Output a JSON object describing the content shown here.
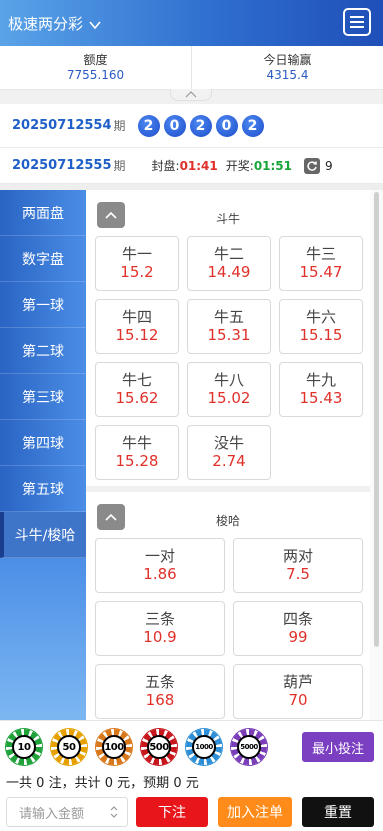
{
  "header": {
    "title": "极速两分彩",
    "title_icon": "chevron-down-icon",
    "menu_icon": "hamburger-menu-icon"
  },
  "balance": {
    "credit_label": "额度",
    "credit_value": "7755.160",
    "today_label": "今日输赢",
    "today_value": "4315.4"
  },
  "last_draw": {
    "issue": "20250712554",
    "unit": "期",
    "balls": [
      "2",
      "0",
      "2",
      "0",
      "2"
    ]
  },
  "next_draw": {
    "issue": "20250712555",
    "unit": "期",
    "close_label": "封盘:",
    "close_time": "01:41",
    "open_label": "开奖:",
    "open_time": "01:51",
    "refresh_icon": "refresh-icon",
    "refresh_count": "9"
  },
  "sidebar": {
    "items": [
      {
        "label": "两面盘",
        "active": false
      },
      {
        "label": "数字盘",
        "active": false
      },
      {
        "label": "第一球",
        "active": false
      },
      {
        "label": "第二球",
        "active": false
      },
      {
        "label": "第三球",
        "active": false
      },
      {
        "label": "第四球",
        "active": false
      },
      {
        "label": "第五球",
        "active": false
      },
      {
        "label": "斗牛/梭哈",
        "active": true
      }
    ]
  },
  "sections": [
    {
      "title": "斗牛",
      "options": [
        {
          "name": "牛一",
          "odds": "15.2"
        },
        {
          "name": "牛二",
          "odds": "14.49"
        },
        {
          "name": "牛三",
          "odds": "15.47"
        },
        {
          "name": "牛四",
          "odds": "15.12"
        },
        {
          "name": "牛五",
          "odds": "15.31"
        },
        {
          "name": "牛六",
          "odds": "15.15"
        },
        {
          "name": "牛七",
          "odds": "15.62"
        },
        {
          "name": "牛八",
          "odds": "15.02"
        },
        {
          "name": "牛九",
          "odds": "15.43"
        },
        {
          "name": "牛牛",
          "odds": "15.28"
        },
        {
          "name": "没牛",
          "odds": "2.74"
        }
      ]
    },
    {
      "title": "梭哈",
      "options": [
        {
          "name": "一对",
          "odds": "1.86"
        },
        {
          "name": "两对",
          "odds": "7.5"
        },
        {
          "name": "三条",
          "odds": "10.9"
        },
        {
          "name": "四条",
          "odds": "99"
        },
        {
          "name": "五条",
          "odds": "168"
        },
        {
          "name": "葫芦",
          "odds": "70"
        }
      ]
    }
  ],
  "chips": [
    {
      "value": "10",
      "color": "#1fa23a"
    },
    {
      "value": "50",
      "color": "#e6a100"
    },
    {
      "value": "100",
      "color": "#d9781b"
    },
    {
      "value": "500",
      "color": "#c8161d"
    },
    {
      "value": "1000",
      "color": "#2f8fd6"
    },
    {
      "value": "5000",
      "color": "#7a3fb8"
    }
  ],
  "min_bet_label": "最小投注",
  "summary": {
    "prefix": "一共",
    "count": "0",
    "count_unit": "注，共计",
    "total": "0",
    "total_unit": "元，预期",
    "expected": "0",
    "expected_unit": "元"
  },
  "amount_input": {
    "placeholder": "请输入金额"
  },
  "buttons": {
    "bet": "下注",
    "add": "加入注单",
    "reset": "重置"
  }
}
